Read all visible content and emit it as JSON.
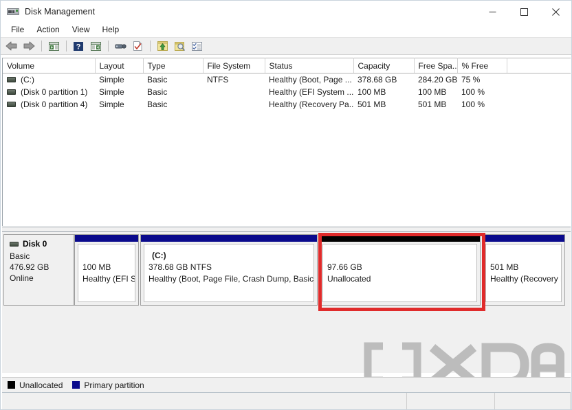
{
  "window": {
    "title": "Disk Management",
    "icon": "disk-drive-icon",
    "controls": {
      "minimize": "—",
      "maximize": "□",
      "close": "✕"
    }
  },
  "menubar": {
    "items": [
      {
        "label": "File",
        "name": "menu-file"
      },
      {
        "label": "Action",
        "name": "menu-action"
      },
      {
        "label": "View",
        "name": "menu-view"
      },
      {
        "label": "Help",
        "name": "menu-help"
      }
    ]
  },
  "toolbar": {
    "buttons": [
      {
        "name": "back-icon"
      },
      {
        "name": "forward-icon"
      },
      {
        "name": "show-hide-console-tree-icon"
      },
      {
        "name": "help-icon"
      },
      {
        "name": "show-hide-action-pane-icon"
      },
      {
        "name": "properties-icon"
      },
      {
        "name": "refresh-icon"
      },
      {
        "name": "rescan-disks-icon"
      },
      {
        "name": "zoom-icon"
      },
      {
        "name": "list-view-icon"
      }
    ]
  },
  "volume_list": {
    "columns": [
      "Volume",
      "Layout",
      "Type",
      "File System",
      "Status",
      "Capacity",
      "Free Spa...",
      "% Free",
      ""
    ],
    "rows": [
      {
        "volume": "(C:)",
        "layout": "Simple",
        "type": "Basic",
        "file_system": "NTFS",
        "status": "Healthy (Boot, Page ...",
        "capacity": "378.68 GB",
        "free_space": "284.20 GB",
        "percent_free": "75 %"
      },
      {
        "volume": "(Disk 0 partition 1)",
        "layout": "Simple",
        "type": "Basic",
        "file_system": "",
        "status": "Healthy (EFI System ...",
        "capacity": "100 MB",
        "free_space": "100 MB",
        "percent_free": "100 %"
      },
      {
        "volume": "(Disk 0 partition 4)",
        "layout": "Simple",
        "type": "Basic",
        "file_system": "",
        "status": "Healthy (Recovery Pa...",
        "capacity": "501 MB",
        "free_space": "501 MB",
        "percent_free": "100 %"
      }
    ]
  },
  "graphical_view": {
    "disk": {
      "name": "Disk 0",
      "type": "Basic",
      "size": "476.92 GB",
      "status": "Online"
    },
    "partitions": [
      {
        "name": "efi-partition",
        "label": "",
        "size": "100 MB",
        "status": "Healthy (EFI Sy",
        "cap_color": "#0a0a8c",
        "kind": "primary"
      },
      {
        "name": "c-partition",
        "label": "(C:)",
        "size": "378.68 GB NTFS",
        "status": "Healthy (Boot, Page File, Crash Dump, Basic Da",
        "cap_color": "#0a0a8c",
        "kind": "primary"
      },
      {
        "name": "unallocated-space",
        "label": "",
        "size": "97.66 GB",
        "status": "Unallocated",
        "cap_color": "#000000",
        "kind": "unallocated"
      },
      {
        "name": "recovery-partition",
        "label": "",
        "size": "501 MB",
        "status": "Healthy (Recovery Pa",
        "cap_color": "#0a0a8c",
        "kind": "primary"
      }
    ],
    "highlight": {
      "color": "#e02b2b",
      "target": "unallocated-space"
    }
  },
  "legend": {
    "items": [
      {
        "label": "Unallocated",
        "color": "#000000",
        "name": "legend-unallocated"
      },
      {
        "label": "Primary partition",
        "color": "#0a0a8c",
        "name": "legend-primary-partition"
      }
    ]
  },
  "statusbar": {
    "text": ""
  },
  "watermark": {
    "text": "XDA"
  }
}
